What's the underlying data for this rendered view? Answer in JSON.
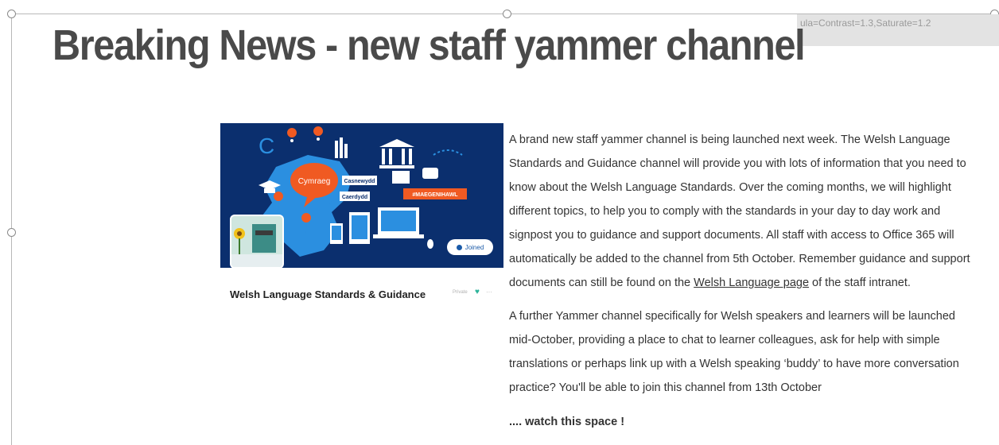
{
  "header": {
    "title": "Breaking News  - new staff yammer channel",
    "formula_text": "ula=Contrast=1.3,Saturate=1.2"
  },
  "card": {
    "tag_cymraeg": "Cymraeg",
    "tag_casnewydd": "Casnewydd",
    "tag_caerdydd": "Caerdydd",
    "hashtag": "#MAEGENIHAWL",
    "joined_label": "Joined",
    "group_name": "Welsh Language Standards & Guidance",
    "meta_label": "Private"
  },
  "body": {
    "p1_line1": "A brand new staff yammer channel is being launched next week. The Welsh Language",
    "p1_line2": "Standards and Guidance channel will provide you with lots of information that you need to",
    "p1_line3": "know about the Welsh Language Standards. Over the coming months, we will highlight",
    "p1_line4": "different topics, to help you to comply with the standards in your day to day work and",
    "p1_line5": "signpost you to guidance and support documents.  All staff with access to Office 365 will",
    "p1_line6": "automatically be added to the channel from 5th October. Remember guidance and support",
    "p1_line7_prefix": "documents can still be found on the ",
    "p1_link": "Welsh Language page",
    "p1_line7_suffix": " of the staff intranet.",
    "p2_line1": "A further Yammer channel specifically for Welsh speakers and learners will be launched",
    "p2_line2": "mid-October, providing a place to chat to learner colleagues, ask for help with simple",
    "p2_line3": "translations or perhaps link up with a Welsh speaking ‘buddy’ to have more conversation",
    "p2_line4": "practice? You'll be able to join this channel from 13th October",
    "p3": ".... watch this space !"
  },
  "colors": {
    "banner_bg": "#0b2f6e",
    "map_blue": "#2b8fe0",
    "accent_orange": "#f05a22",
    "title_gray": "#4a4a4a"
  },
  "icons": [
    "map-pin-icon",
    "speech-bubble-icon",
    "bank-icon",
    "graduation-cap-icon",
    "laptop-icon",
    "phone-icon",
    "tablet-icon",
    "book-icon",
    "mouse-icon",
    "heart-icon",
    "more-icon"
  ]
}
